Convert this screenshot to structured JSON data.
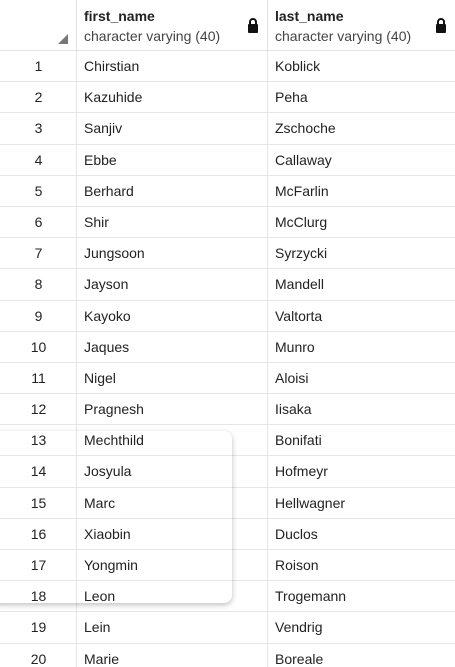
{
  "columns": [
    {
      "name": "first_name",
      "type": "character varying (40)"
    },
    {
      "name": "last_name",
      "type": "character varying (40)"
    }
  ],
  "rows": [
    {
      "n": "1",
      "first_name": "Chirstian",
      "last_name": "Koblick"
    },
    {
      "n": "2",
      "first_name": "Kazuhide",
      "last_name": "Peha"
    },
    {
      "n": "3",
      "first_name": "Sanjiv",
      "last_name": "Zschoche"
    },
    {
      "n": "4",
      "first_name": "Ebbe",
      "last_name": "Callaway"
    },
    {
      "n": "5",
      "first_name": "Berhard",
      "last_name": "McFarlin"
    },
    {
      "n": "6",
      "first_name": "Shir",
      "last_name": "McClurg"
    },
    {
      "n": "7",
      "first_name": "Jungsoon",
      "last_name": "Syrzycki"
    },
    {
      "n": "8",
      "first_name": "Jayson",
      "last_name": "Mandell"
    },
    {
      "n": "9",
      "first_name": "Kayoko",
      "last_name": "Valtorta"
    },
    {
      "n": "10",
      "first_name": "Jaques",
      "last_name": "Munro"
    },
    {
      "n": "11",
      "first_name": "Nigel",
      "last_name": "Aloisi"
    },
    {
      "n": "12",
      "first_name": "Pragnesh",
      "last_name": "Iisaka"
    },
    {
      "n": "13",
      "first_name": "Mechthild",
      "last_name": "Bonifati"
    },
    {
      "n": "14",
      "first_name": "Josyula",
      "last_name": "Hofmeyr"
    },
    {
      "n": "15",
      "first_name": "Marc",
      "last_name": "Hellwagner"
    },
    {
      "n": "16",
      "first_name": "Xiaobin",
      "last_name": "Duclos"
    },
    {
      "n": "17",
      "first_name": "Yongmin",
      "last_name": "Roison"
    },
    {
      "n": "18",
      "first_name": "Leon",
      "last_name": "Trogemann"
    },
    {
      "n": "19",
      "first_name": "Lein",
      "last_name": "Vendrig"
    },
    {
      "n": "20",
      "first_name": "Marie",
      "last_name": "Boreale"
    }
  ],
  "icons": {
    "lock": "lock-icon",
    "sort": "sort-indicator-icon"
  },
  "colors": {
    "border": "#dee2e6",
    "text": "#222222"
  }
}
